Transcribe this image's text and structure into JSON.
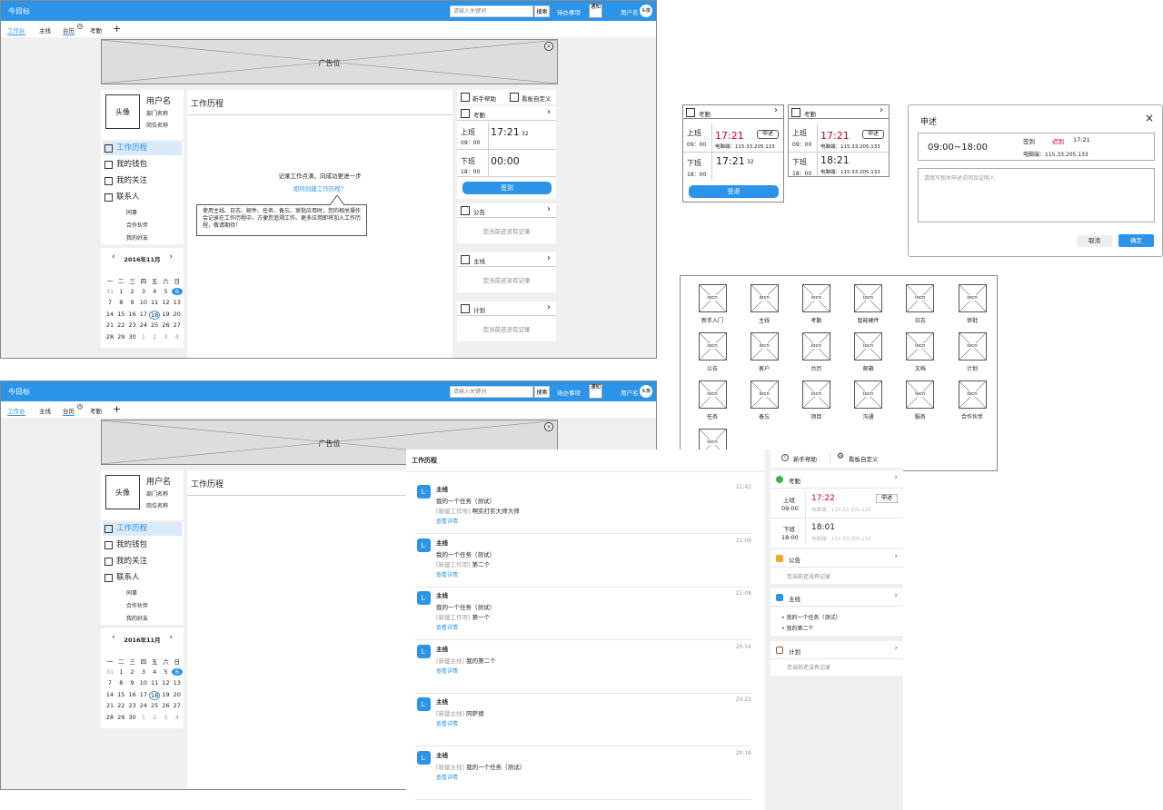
{
  "topbar": {
    "title": "今目标",
    "search_placeholder": "请输入关键词",
    "search_btn": "搜索",
    "todo": "待办事项",
    "notify": "通知",
    "username": "用户名",
    "avatar": "头像"
  },
  "tabs": [
    "工作台",
    "主线",
    "台历",
    "考勤"
  ],
  "tab_badge": "+",
  "ad": {
    "label": "广告位"
  },
  "profile": {
    "avatar": "头像",
    "name": "用户名",
    "dept": "部门名称",
    "post": "岗位名称"
  },
  "menu": [
    "工作历程",
    "我的钱包",
    "我的关注",
    "联系人"
  ],
  "contacts_sub": [
    "同事",
    "合作伙伴",
    "我的好友"
  ],
  "calendar": {
    "month": "2016年11月",
    "weekdays": [
      "一",
      "二",
      "三",
      "四",
      "五",
      "六",
      "日"
    ],
    "rows": [
      [
        "31",
        "1",
        "2",
        "3",
        "4",
        "5",
        "6"
      ],
      [
        "7",
        "8",
        "9",
        "10",
        "11",
        "12",
        "13"
      ],
      [
        "14",
        "15",
        "16",
        "17",
        "18",
        "19",
        "20"
      ],
      [
        "21",
        "22",
        "23",
        "24",
        "25",
        "26",
        "27"
      ],
      [
        "28",
        "29",
        "30",
        "1",
        "2",
        "3",
        "4"
      ]
    ]
  },
  "work_history": {
    "title": "工作历程",
    "empty_line1": "记录工作点滴，向成功更进一步",
    "how_link": "如何创建工作历程？",
    "tip": "使用主线、日志、邮件、任务、备忘、审批应用时，您的相关操作会记录在工作历程中，方便您追溯工作。更多应用即将加入工作历程，敬请期待！"
  },
  "right_panel": {
    "help": "新手帮助",
    "customize": "看板自定义",
    "attendance": "考勤",
    "on": "上班",
    "on_time": "09：00",
    "off": "下班",
    "off_time": "18：00",
    "on_clock": "17:21",
    "on_sec": "32",
    "off_clock": "00:00",
    "sign_btn": "签到",
    "notice": "公告",
    "notice_empty": "您当前还没有记录",
    "mainline": "主线",
    "mainline_empty": "您当前还没有记录",
    "plan": "计划",
    "plan_empty": "您当前还没有记录"
  },
  "att_card1": {
    "title": "考勤",
    "on": "上班",
    "on_time": "09：00",
    "on_clock": "17:21",
    "apply": "申述",
    "ip": "电脑端：115.33.205.133",
    "off": "下班",
    "off_time": "18：00",
    "off_clock": "17:21",
    "off_sec": "32",
    "btn": "签退"
  },
  "att_card2": {
    "title": "考勤",
    "on": "上班",
    "on_time": "09：00",
    "on_clock": "17:21",
    "apply": "申述",
    "ip": "电脑端：115.33.205.133",
    "off": "下班",
    "off_time": "18：00",
    "off_clock": "18:21",
    "ip2": "电脑端：115.33.205.133"
  },
  "dialog": {
    "title": "申述",
    "close": "×",
    "range": "09:00~18:00",
    "sign": "签到",
    "late": "迟到",
    "time": "17:21",
    "ip": "电脑端：115.33.205.133",
    "placeholder": "请填写相关申述说明及证明人",
    "cancel": "取消",
    "ok": "确定"
  },
  "apps": {
    "icon_label": "iocn",
    "names": [
      "新手入门",
      "主线",
      "考勤",
      "智能硬件",
      "日志",
      "审批",
      "公告",
      "客户",
      "台历",
      "邮箱",
      "文档",
      "计划",
      "任务",
      "备忘",
      "项目",
      "沟通",
      "服务",
      "合作伙伴",
      ""
    ]
  },
  "history_list": {
    "title": "工作历程",
    "detail": "查看详情",
    "items": [
      {
        "app": "主线",
        "time": "21:42",
        "line1": "我的一个任务（测试）",
        "tag": "[新建工作项]",
        "text": "啊实打实大师大师"
      },
      {
        "app": "主线",
        "time": "21:09",
        "line1": "我的一个任务（测试）",
        "tag": "[新建工作项]",
        "text": "第二个"
      },
      {
        "app": "主线",
        "time": "21:08",
        "line1": "我的一个任务（测试）",
        "tag": "[新建工作项]",
        "text": "第一个"
      },
      {
        "app": "主线",
        "time": "20:54",
        "line1": "",
        "tag": "[新建主线]",
        "text": "我的第二个"
      },
      {
        "app": "主线",
        "time": "20:22",
        "line1": "",
        "tag": "[新建主线]",
        "text": "阿萨德"
      },
      {
        "app": "主线",
        "time": "20:18",
        "line1": "",
        "tag": "[新建主线]",
        "text": "我的一个任务（测试）"
      }
    ]
  },
  "right_panel2": {
    "help": "新手帮助",
    "customize": "看板自定义",
    "attendance": "考勤",
    "on": "上班",
    "on_time": "09:00",
    "on_clock": "17:22",
    "apply": "申述",
    "ip": "电脑端：115.33.205.133",
    "off": "下班",
    "off_time": "18:00",
    "off_clock": "18:01",
    "ip2": "电脑端：115.33.205.133",
    "notice": "公告",
    "notice_empty": "您当前还没有记录",
    "mainline": "主线",
    "ml_items": [
      "我的一个任务（测试）",
      "我的第二个"
    ],
    "plan": "计划",
    "plan_empty": "您当前还没有记录"
  },
  "colors": {
    "accent": "#2b93e8",
    "late": "#d0021b"
  }
}
